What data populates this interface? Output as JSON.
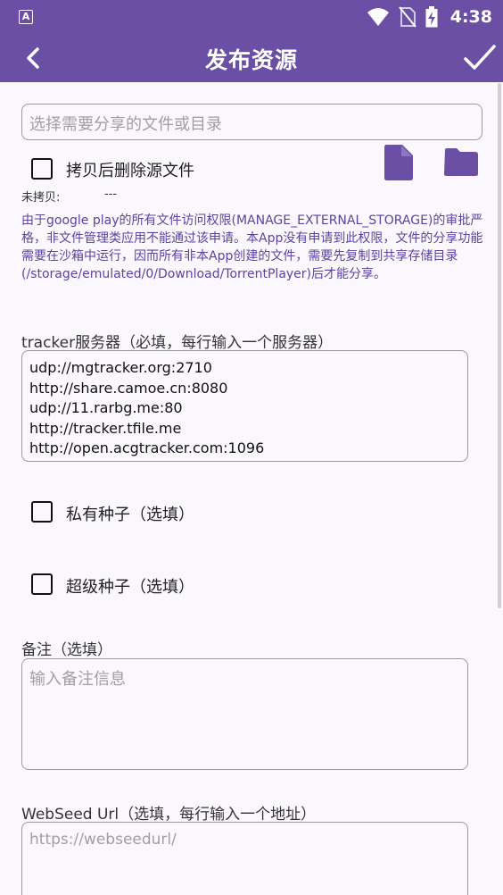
{
  "statusbar": {
    "app_icon_letter": "A",
    "time": "4:38"
  },
  "appbar": {
    "title": "发布资源"
  },
  "file_picker": {
    "placeholder": "选择需要分享的文件或目录"
  },
  "delete_after_copy": {
    "label": "拷贝后删除源文件",
    "checked": false
  },
  "copy_status": {
    "label": "未拷贝:",
    "value": "---"
  },
  "notice": "由于google play的所有文件访问权限(MANAGE_EXTERNAL_STORAGE)的审批严格，非文件管理类应用不能通过该申请。本App没有申请到此权限，文件的分享功能需要在沙箱中运行，因而所有非本App创建的文件，需要先复制到共享存储目录(/storage/emulated/0/Download/TorrentPlayer)后才能分享。",
  "tracker": {
    "label": "tracker服务器（必填，每行输入一个服务器）",
    "lines": [
      "udp://mgtracker.org:2710",
      "http://share.camoe.cn:8080",
      "udp://11.rarbg.me:80",
      "http://tracker.tfile.me",
      "http://open.acgtracker.com:1096"
    ]
  },
  "private_torrent": {
    "label": "私有种子（选填）",
    "checked": false
  },
  "super_torrent": {
    "label": "超级种子（选填）",
    "checked": false
  },
  "remark": {
    "label": "备注（选填）",
    "placeholder": "输入备注信息"
  },
  "webseed": {
    "label": "WebSeed Url（选填，每行输入一个地址）",
    "placeholder": "https://webseedurl/"
  },
  "colors": {
    "primary": "#6a4fa5",
    "notice_text": "#5e42a0",
    "background": "#fbf8fd"
  }
}
